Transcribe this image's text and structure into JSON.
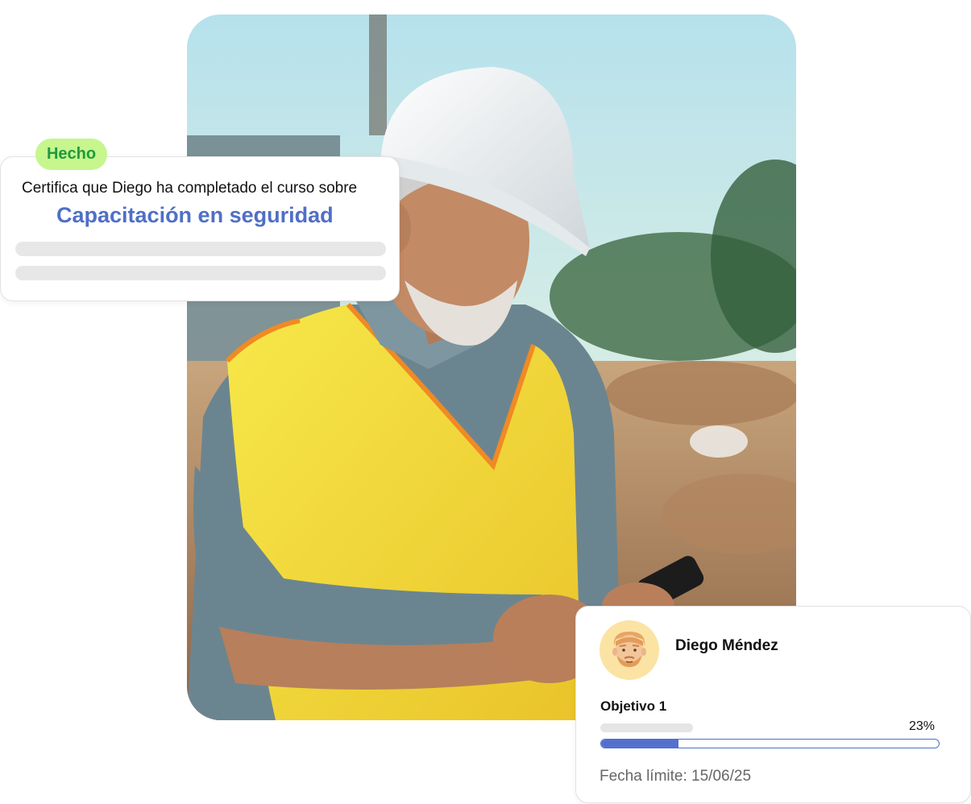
{
  "certificate": {
    "badge": "Hecho",
    "text": "Certifica que Diego ha completado el curso sobre",
    "course": "Capacitación en seguridad"
  },
  "profile": {
    "name": "Diego Méndez",
    "goal_label": "Objetivo 1",
    "progress": 0.23,
    "progress_text": "23%",
    "deadline_label": "Fecha límite:",
    "deadline_value": "15/06/25"
  },
  "colors": {
    "accent": "#4f6fc7",
    "badge_bg": "#c6f68d",
    "badge_text": "#1f9a3e"
  }
}
